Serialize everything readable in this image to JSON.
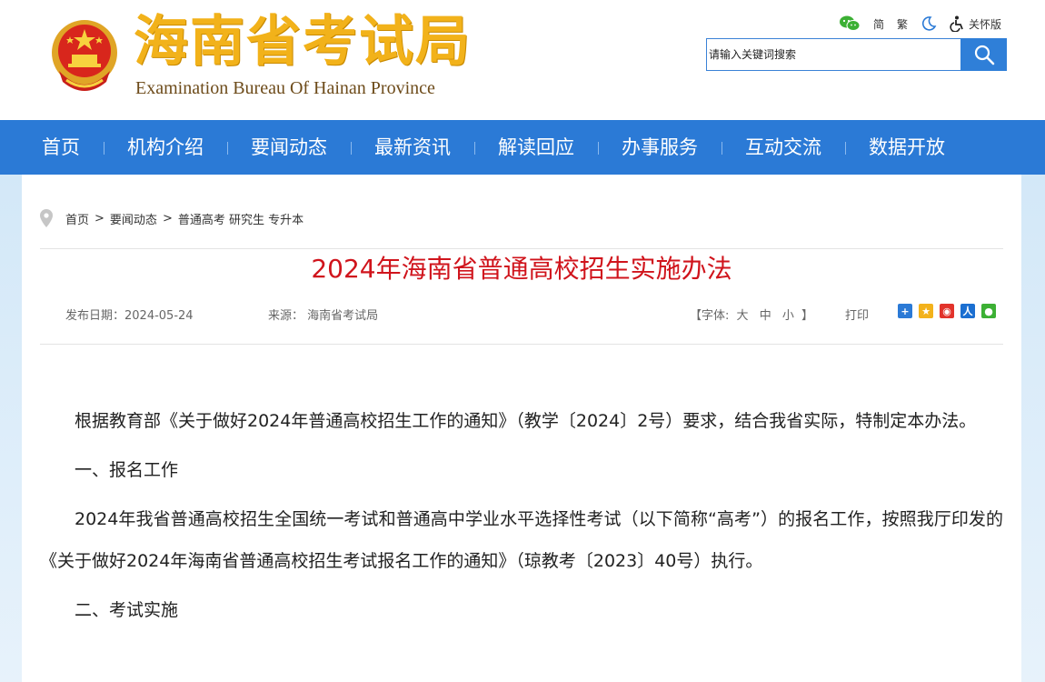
{
  "header": {
    "title": "海南省考试局",
    "subtitle": "Examination Bureau Of Hainan Province"
  },
  "tools": {
    "simplified": "简",
    "traditional": "繁",
    "care": "关怀版"
  },
  "search": {
    "placeholder": "请输入关键词搜索"
  },
  "nav": {
    "items": [
      "首页",
      "机构介绍",
      "要闻动态",
      "最新资讯",
      "解读回应",
      "办事服务",
      "互动交流",
      "数据开放"
    ]
  },
  "breadcrumb": {
    "home": "首页",
    "level2": "要闻动态",
    "level3": "普通高考 研究生 专升本",
    "separator": ">"
  },
  "article": {
    "title": "2024年海南省普通高校招生实施办法",
    "publish_date": "发布日期：2024-05-24",
    "source": "来源：  海南省考试局",
    "font_label_open": "【字体:",
    "font_large": "大",
    "font_medium": "中",
    "font_small": "小",
    "font_label_close": "】",
    "print": "打印",
    "paragraphs": [
      "根据教育部《关于做好2024年普通高校招生工作的通知》（教学〔2024〕2号）要求，结合我省实际，特制定本办法。",
      "一、报名工作",
      "2024年我省普通高校招生全国统一考试和普通高中学业水平选择性考试（以下简称“高考”）的报名工作，按照我厅印发的《关于做好2024年海南省普通高校招生考试报名工作的通知》（琼教考〔2023〕40号）执行。",
      "二、考试实施"
    ]
  },
  "colors": {
    "nav_bg": "#2b7ad6",
    "title_red": "#d0141c",
    "logo_gold": "#f2b21a"
  }
}
